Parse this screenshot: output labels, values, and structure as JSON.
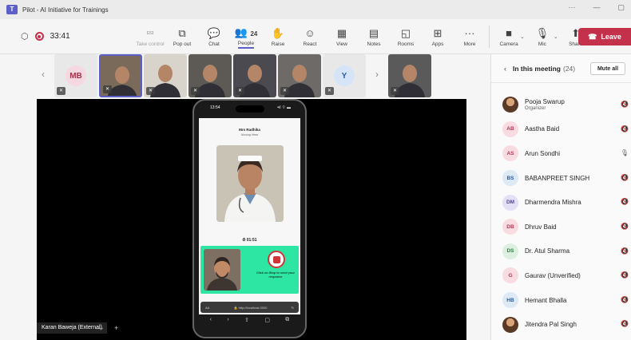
{
  "window": {
    "title": "Pilot - AI Initiative for Trainings",
    "controls": [
      "···",
      "—",
      "▢"
    ]
  },
  "toolbar": {
    "timer": "33:41",
    "tools": [
      {
        "label": "Take control",
        "icon": "⮹",
        "dim": true
      },
      {
        "label": "Pop out",
        "icon": "⧉"
      },
      {
        "label": "Chat",
        "icon": "💬"
      },
      {
        "label": "People",
        "icon": "👥",
        "count": "24",
        "active": true
      },
      {
        "label": "Raise",
        "icon": "✋"
      },
      {
        "label": "React",
        "icon": "☺"
      },
      {
        "label": "View",
        "icon": "▦"
      },
      {
        "label": "Notes",
        "icon": "▤"
      },
      {
        "label": "Rooms",
        "icon": "◱"
      },
      {
        "label": "Apps",
        "icon": "⊞"
      },
      {
        "label": "More",
        "icon": "···"
      }
    ],
    "devices": [
      {
        "label": "Camera",
        "icon": "■"
      },
      {
        "label": "Mic",
        "icon": "🎙"
      },
      {
        "label": "Share",
        "icon": "⬆"
      }
    ],
    "leave_label": "Leave",
    "accent": "#5b5fc7",
    "leave_color": "#c4314b"
  },
  "gallery": {
    "tiles": [
      {
        "type": "avatar",
        "initials": "MB",
        "bg": "#f6d8e0",
        "fg": "#a0344b"
      },
      {
        "type": "video",
        "bg": "#7a6a5a",
        "selected": true
      },
      {
        "type": "video",
        "bg": "#d8d4cc"
      },
      {
        "type": "video",
        "bg": "#5d5a55"
      },
      {
        "type": "video",
        "bg": "#4a4a50"
      },
      {
        "type": "video",
        "bg": "#6d6a68"
      },
      {
        "type": "avatar",
        "initials": "Y",
        "bg": "#d6e4f7",
        "fg": "#2d5aa0"
      },
      {
        "type": "video",
        "bg": "#5a5a5a"
      }
    ]
  },
  "stage": {
    "presenter": "Karan Baweja (External)",
    "phone": {
      "clock": "13:54",
      "status_right": "•ıl ⌔ ▬",
      "agent_name": "Mrs Radhika",
      "agent_role": "Nursing Head",
      "countdown": "01:51",
      "stop_hint": "Click on Stop to send your response",
      "url_left": "AA",
      "url": "🔒 http://localhost:3000",
      "url_right": "↻",
      "nav": [
        "‹",
        "›",
        "⇧",
        "▢",
        "⧉"
      ]
    }
  },
  "panel": {
    "title": "In this meeting",
    "count": "(24)",
    "mute_all": "Mute all",
    "participants": [
      {
        "name": "Pooja Swarup",
        "role": "Organizer",
        "initials": "",
        "photo": true,
        "mic": "muted"
      },
      {
        "name": "Aastha Baid",
        "initials": "AB",
        "bg": "#f9dbe2",
        "fg": "#b33a54",
        "mic": "muted"
      },
      {
        "name": "Arun Sondhi",
        "initials": "AS",
        "bg": "#f9dbe2",
        "fg": "#b33a54",
        "mic": "on"
      },
      {
        "name": "BABANPREET SINGH",
        "initials": "BS",
        "bg": "#dde9f5",
        "fg": "#2c5d93",
        "mic": "muted"
      },
      {
        "name": "Dharmendra Mishra",
        "initials": "DM",
        "bg": "#e3e0f5",
        "fg": "#4f46a6",
        "mic": "muted"
      },
      {
        "name": "Dhruv Baid",
        "initials": "DB",
        "bg": "#f9dbe2",
        "fg": "#b33a54",
        "mic": "muted"
      },
      {
        "name": "Dr. Atul Sharma",
        "initials": "DS",
        "bg": "#dcefe0",
        "fg": "#2e7d45",
        "mic": "muted"
      },
      {
        "name": "Gaurav (Unverified)",
        "initials": "G",
        "bg": "#f9dbe2",
        "fg": "#b33a54",
        "mic": "muted"
      },
      {
        "name": "Hemant Bhalla",
        "initials": "HB",
        "bg": "#dde9f5",
        "fg": "#2c5d93",
        "mic": "muted"
      },
      {
        "name": "Jitendra Pal Singh",
        "initials": "",
        "photo": true,
        "mic": "muted"
      }
    ]
  }
}
